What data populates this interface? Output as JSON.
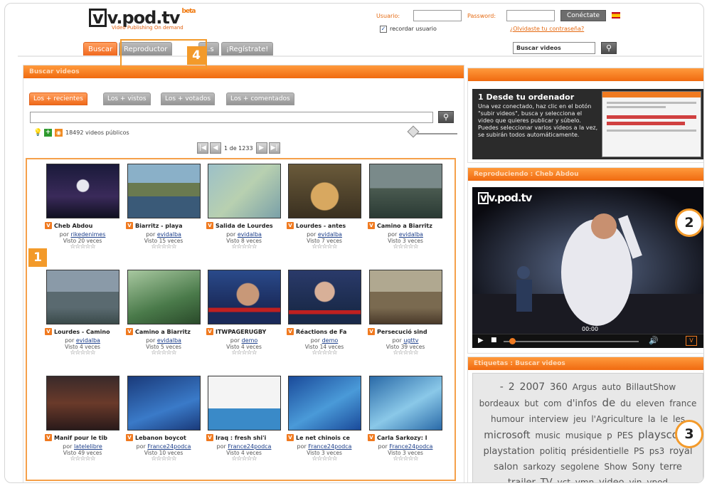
{
  "header": {
    "logo_text": "v.pod.tv",
    "logo_badge": "beta",
    "tagline": "Video Publishing On demand",
    "username_label": "Usuario:",
    "password_label": "Password:",
    "connect_button": "Conéctate",
    "remember_label": "recordar usuario",
    "forgot_link": "¿Olvidaste tu contraseña?",
    "search_placeholder": "Buscar videos"
  },
  "nav": {
    "tabs": [
      {
        "label": "Buscar",
        "active": true
      },
      {
        "label": "Reproductor",
        "active": false
      },
      {
        "label": "...s",
        "active": false
      },
      {
        "label": "¡Regístrate!",
        "active": false
      }
    ]
  },
  "search_panel": {
    "title": "Buscar videos",
    "subtabs": [
      "Los + recientes",
      "Los + vistos",
      "Los + votados",
      "Los + comentados"
    ],
    "count_text": "18492 videos públicos",
    "pager_text": "1 de 1233"
  },
  "videos": [
    {
      "title": "Cheb Abdou",
      "by_label": "por",
      "author": "rikedenimes",
      "views": "Visto 20 veces"
    },
    {
      "title": "Biarritz - playa",
      "by_label": "por",
      "author": "evidalba",
      "views": "Visto 15 veces"
    },
    {
      "title": "Salida de Lourdes",
      "by_label": "por",
      "author": "evidalba",
      "views": "Visto 8 veces"
    },
    {
      "title": "Lourdes - antes",
      "by_label": "por",
      "author": "evidalba",
      "views": "Visto 7 veces"
    },
    {
      "title": "Camino a Biarritz",
      "by_label": "por",
      "author": "evidalba",
      "views": "Visto 3 veces"
    },
    {
      "title": "Lourdes - Camino",
      "by_label": "por",
      "author": "evidalba",
      "views": "Visto 4 veces"
    },
    {
      "title": "Camino a Biarritz",
      "by_label": "por",
      "author": "evidalba",
      "views": "Visto 5 veces"
    },
    {
      "title": "ITWPAGERUGBY",
      "by_label": "por",
      "author": "demo",
      "views": "Visto 4 veces"
    },
    {
      "title": "Réactions de Fa",
      "by_label": "por",
      "author": "demo",
      "views": "Visto 14 veces"
    },
    {
      "title": "Persecució sind",
      "by_label": "por",
      "author": "ugttv",
      "views": "Visto 39 veces"
    },
    {
      "title": "Manif pour le tib",
      "by_label": "por",
      "author": "latelelibre",
      "views": "Visto 49 veces"
    },
    {
      "title": "Lebanon boycot",
      "by_label": "por",
      "author": "France24podca",
      "views": "Visto 10 veces"
    },
    {
      "title": "Iraq : fresh shi'i",
      "by_label": "por",
      "author": "France24podca",
      "views": "Visto 4 veces"
    },
    {
      "title": "Le net chinois ce",
      "by_label": "por",
      "author": "France24podca",
      "views": "Visto 3 veces"
    },
    {
      "title": "Carla Sarkozy: l",
      "by_label": "por",
      "author": "France24podca",
      "views": "Visto 3 veces"
    }
  ],
  "upload": {
    "title": "1 Desde tu ordenador",
    "text": "Una vez conectado, haz clic en el botón \"subir videos\", busca y selecciona el video que quieres publicar y súbelo. Puedes seleccionar varios videos a la vez, se subirán todos automáticamente."
  },
  "player": {
    "title": "Reproduciendo : Cheb Abdou",
    "logo_text": "v.pod.tv",
    "time": "00:00"
  },
  "tags": {
    "title": "Etiquetas : Buscar videos",
    "items": [
      {
        "text": "-",
        "size": 14
      },
      {
        "text": "2",
        "size": 14
      },
      {
        "text": "2007",
        "size": 14
      },
      {
        "text": "360",
        "size": 13
      },
      {
        "text": "Argus",
        "size": 12
      },
      {
        "text": "auto",
        "size": 12
      },
      {
        "text": "BillautShow",
        "size": 12
      },
      {
        "text": "bordeaux",
        "size": 12
      },
      {
        "text": "but",
        "size": 12
      },
      {
        "text": "com",
        "size": 12
      },
      {
        "text": "d'infos",
        "size": 13
      },
      {
        "text": "de",
        "size": 15
      },
      {
        "text": "du",
        "size": 12
      },
      {
        "text": "eleven",
        "size": 12
      },
      {
        "text": "france",
        "size": 12
      },
      {
        "text": "humour",
        "size": 12
      },
      {
        "text": "interview",
        "size": 12
      },
      {
        "text": "jeu",
        "size": 12
      },
      {
        "text": "l'Agriculture",
        "size": 12
      },
      {
        "text": "la",
        "size": 12
      },
      {
        "text": "le",
        "size": 12
      },
      {
        "text": "les",
        "size": 12
      },
      {
        "text": "microsoft",
        "size": 14
      },
      {
        "text": "music",
        "size": 12
      },
      {
        "text": "musique",
        "size": 12
      },
      {
        "text": "p",
        "size": 12
      },
      {
        "text": "PES",
        "size": 12
      },
      {
        "text": "playscope",
        "size": 15
      },
      {
        "text": "playstation",
        "size": 13
      },
      {
        "text": "politiq",
        "size": 12
      },
      {
        "text": "présidentielle",
        "size": 12
      },
      {
        "text": "PS",
        "size": 12
      },
      {
        "text": "ps3",
        "size": 12
      },
      {
        "text": "royal",
        "size": 13
      },
      {
        "text": "salon",
        "size": 13
      },
      {
        "text": "sarkozy",
        "size": 12
      },
      {
        "text": "segolene",
        "size": 12
      },
      {
        "text": "Show",
        "size": 12
      },
      {
        "text": "Sony",
        "size": 13
      },
      {
        "text": "terre",
        "size": 13
      },
      {
        "text": "trailer",
        "size": 13
      },
      {
        "text": "TV",
        "size": 13
      },
      {
        "text": "vct",
        "size": 12
      },
      {
        "text": "vmn",
        "size": 12
      },
      {
        "text": "video",
        "size": 13
      },
      {
        "text": "vin",
        "size": 12
      },
      {
        "text": "vpod",
        "size": 12
      }
    ]
  },
  "callouts": {
    "one": "1",
    "two": "2",
    "three": "3",
    "four": "4"
  },
  "colors": {
    "accent": "#f06a10",
    "callout": "#f39a2a",
    "link": "#1d3f8a"
  }
}
